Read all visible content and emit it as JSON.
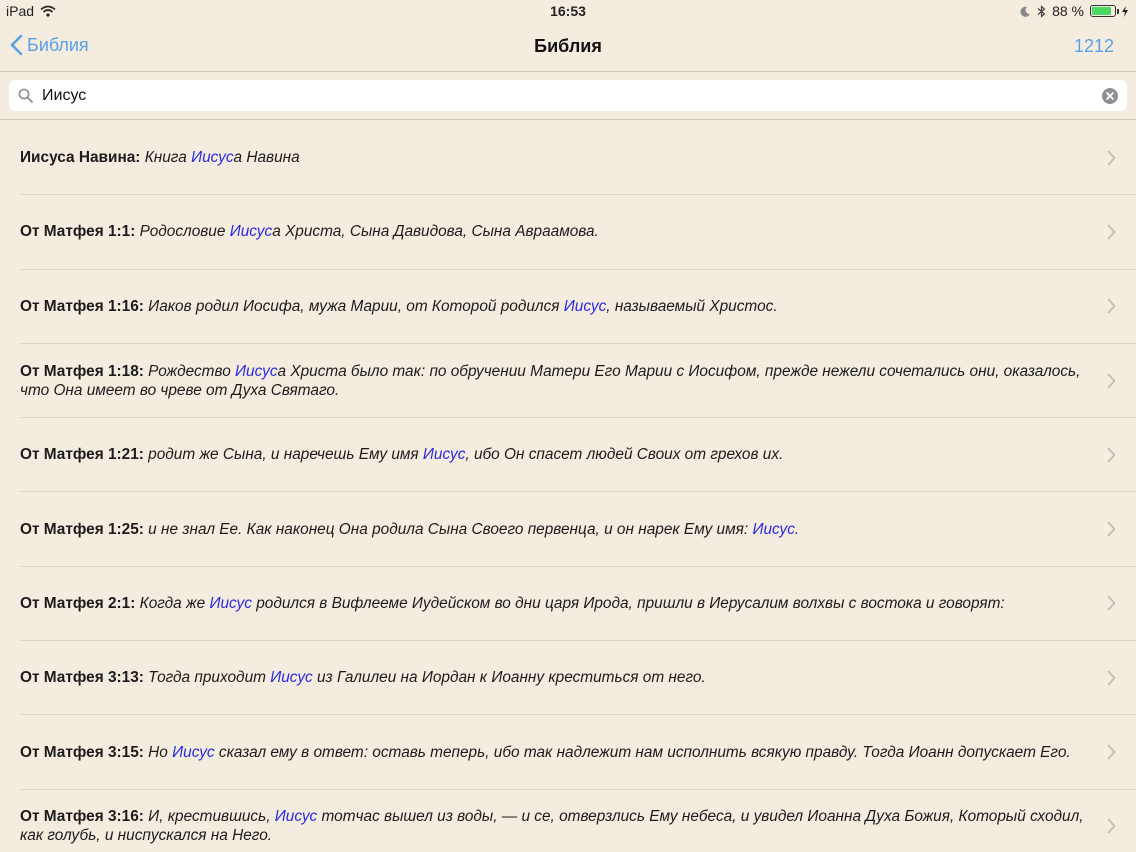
{
  "status": {
    "device": "iPad",
    "time": "16:53",
    "battery": "88 %",
    "battery_level": 0.88
  },
  "nav": {
    "back_label": "Библия",
    "title": "Библия",
    "count": "1212"
  },
  "search": {
    "value": "Иисус"
  },
  "results": [
    {
      "ref": "Иисуса Навина:",
      "parts": [
        " Книга ",
        "Иисус",
        "а Навина"
      ]
    },
    {
      "ref": "От Матфея 1:1:",
      "parts": [
        " Родословие ",
        "Иисус",
        "а Христа, Сына Давидова, Сына Авраамова."
      ]
    },
    {
      "ref": "От Матфея 1:16:",
      "parts": [
        " Иаков родил Иосифа, мужа Марии, от Которой родился ",
        "Иисус",
        ", называемый Христос."
      ]
    },
    {
      "ref": "От Матфея 1:18:",
      "parts": [
        " Рождество ",
        "Иисус",
        "а Христа было так: по обручении Матери Его Марии с Иосифом, прежде нежели сочетались они, оказалось, что Она имеет во чреве от Духа Святаго."
      ]
    },
    {
      "ref": "От Матфея 1:21:",
      "parts": [
        " родит же Сына, и наречешь Ему имя ",
        "Иисус",
        ", ибо Он спасет людей Своих от грехов их."
      ]
    },
    {
      "ref": "От Матфея 1:25:",
      "parts": [
        " и не знал Ее. Как наконец Она родила Сына Своего первенца, и он нарек Ему имя: ",
        "Иисус",
        "."
      ]
    },
    {
      "ref": "От Матфея 2:1:",
      "parts": [
        " Когда же ",
        "Иисус",
        " родился в Вифлееме Иудейском во дни царя Ирода, пришли в Иерусалим волхвы с востока и говорят:"
      ]
    },
    {
      "ref": "От Матфея 3:13:",
      "parts": [
        " Тогда приходит ",
        "Иисус",
        " из Галилеи на Иордан к Иоанну креститься от него."
      ]
    },
    {
      "ref": "От Матфея 3:15:",
      "parts": [
        " Но ",
        "Иисус",
        " сказал ему в ответ: оставь теперь, ибо так надлежит нам исполнить всякую правду. Тогда Иоанн допускает Его."
      ]
    },
    {
      "ref": "От Матфея 3:16:",
      "parts": [
        " И, крестившись, ",
        "Иисус",
        " тотчас вышел из воды, — и се, отверзлись Ему небеса, и увидел Иоанна Духа Божия, Который сходил, как голубь, и ниспускался на Него."
      ]
    }
  ],
  "colors": {
    "background": "#f4ecdf",
    "accent": "#5aa0e6",
    "highlight": "#2a2ae0",
    "battery": "#4cd964"
  },
  "icons": {
    "wifi": "wifi-icon",
    "moon": "moon-icon",
    "bluetooth": "bluetooth-icon",
    "battery": "battery-icon",
    "back": "chevron-left-icon",
    "search": "search-icon",
    "clear": "clear-icon",
    "row": "chevron-right-icon"
  }
}
